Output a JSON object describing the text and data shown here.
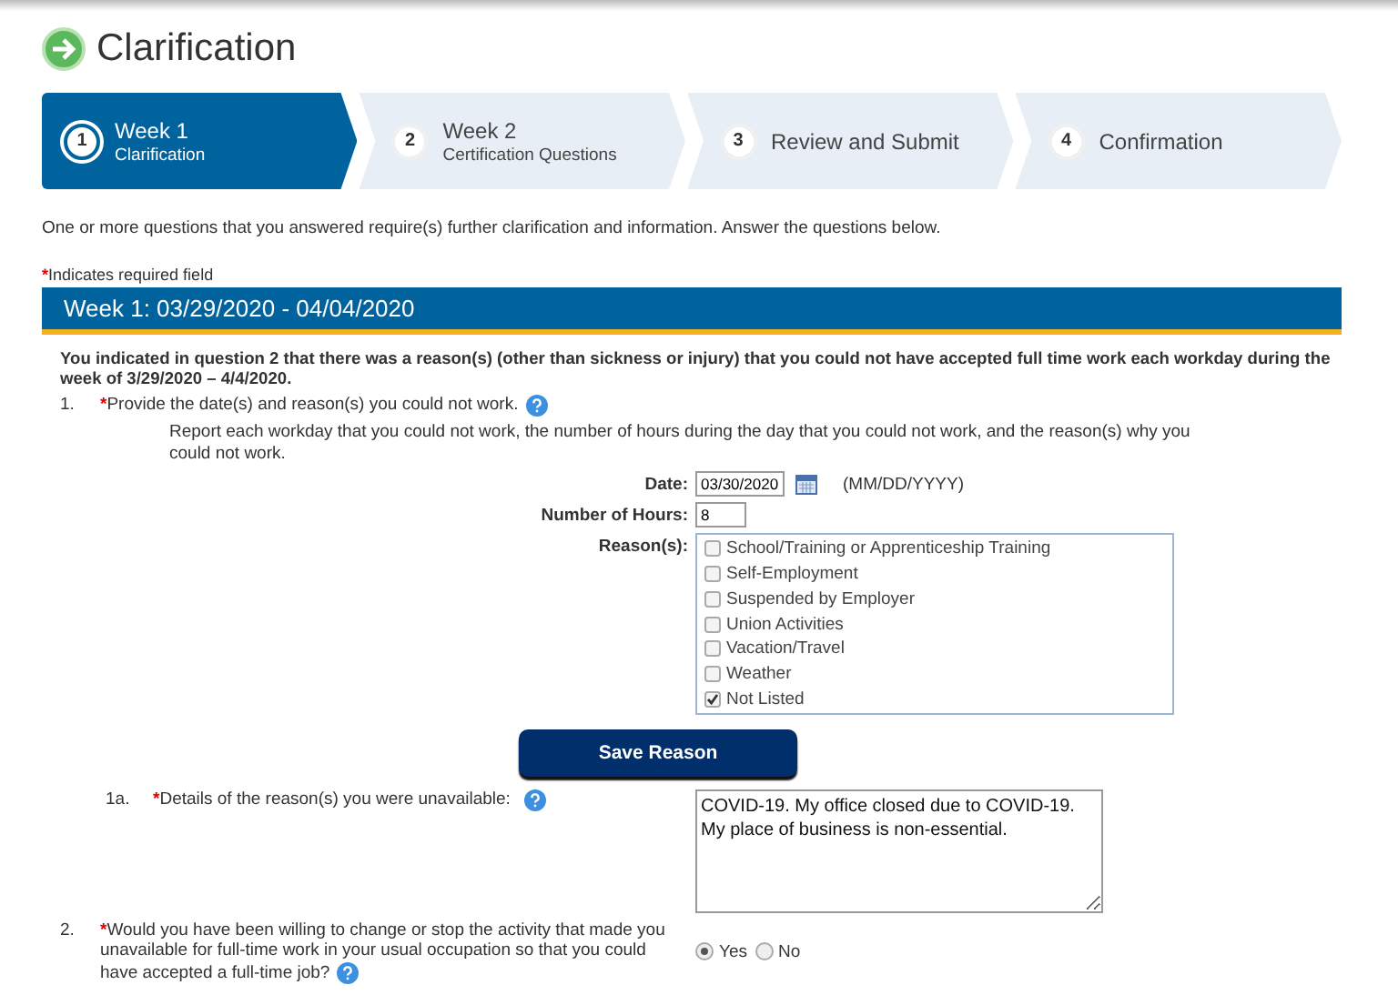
{
  "page": {
    "title": "Clarification"
  },
  "steps": [
    {
      "number": "1",
      "title": "Week 1",
      "subtitle": "Clarification",
      "selected": true
    },
    {
      "number": "2",
      "title": "Week 2",
      "subtitle": "Certification Questions",
      "selected": false
    },
    {
      "number": "3",
      "title": "Review and Submit",
      "selected": false
    },
    {
      "number": "4",
      "title": "Confirmation",
      "selected": false
    }
  ],
  "intro": "One or more questions that you answered require(s) further clarification and information. Answer the questions below.",
  "required_note": {
    "marker": "*",
    "text": "Indicates required field"
  },
  "week_header": "Week 1: 03/29/2020 -  04/04/2020",
  "summary": "You indicated in question 2 that there was a reason(s) (other than sickness or injury) that you could not have accepted full time work each workday during the week of 3/29/2020 – 4/4/2020.",
  "question_1": {
    "number": "1.",
    "marker": "*",
    "text": "Provide the date(s) and reason(s) you could not work.",
    "instructions": "Report each workday that you could not work, the number of hours during the day that you could not work, and the reason(s) why you could not work.",
    "date": {
      "label": "Date:",
      "value": "03/30/2020",
      "format": "(MM/DD/YYYY)"
    },
    "hours": {
      "label": "Number of Hours:",
      "value": "8"
    },
    "reasons": {
      "label": "Reason(s):",
      "options": [
        {
          "label": "School/Training or Apprenticeship Training",
          "checked": false
        },
        {
          "label": "Self-Employment",
          "checked": false
        },
        {
          "label": "Suspended by Employer",
          "checked": false
        },
        {
          "label": "Union Activities",
          "checked": false
        },
        {
          "label": "Vacation/Travel",
          "checked": false
        },
        {
          "label": "Weather",
          "checked": false
        },
        {
          "label": "Not Listed",
          "checked": true
        }
      ]
    },
    "button": "Save Reason"
  },
  "question_1a": {
    "number": "1a.",
    "marker": "*",
    "text": "Details of the reason(s) you were unavailable:",
    "value": "COVID-19. My office closed due to COVID-19. My place of business is non-essential."
  },
  "question_2": {
    "number": "2.",
    "marker": "*",
    "text": "Would you have been willing to change or stop the activity that made you unavailable for full-time work in your usual occupation so that you could have accepted a full-time job?",
    "options": [
      {
        "label": "Yes",
        "selected": true
      },
      {
        "label": "No",
        "selected": false
      }
    ]
  }
}
